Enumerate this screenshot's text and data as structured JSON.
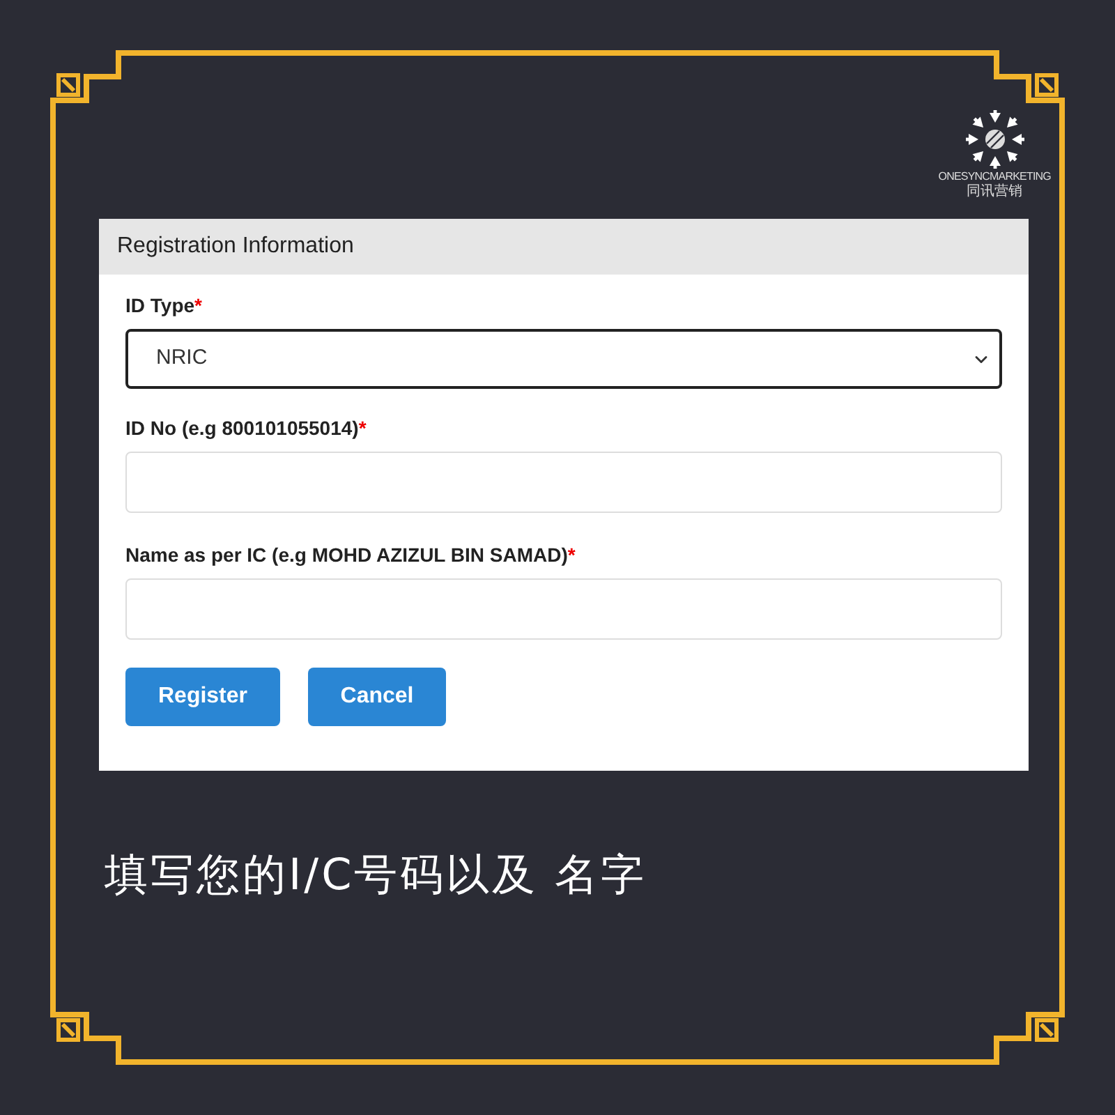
{
  "logo": {
    "name": "ONESYNCMARKETING",
    "subtitle": "同讯营销"
  },
  "form": {
    "title": "Registration Information",
    "fields": [
      {
        "kind": "select",
        "label": "ID Type",
        "required": "*",
        "value": "NRIC"
      },
      {
        "kind": "text",
        "label": "ID No (e.g 800101055014)",
        "required": "*"
      },
      {
        "kind": "text",
        "label": "Name as per IC (e.g MOHD AZIZUL BIN SAMAD)",
        "required": "*"
      }
    ],
    "buttons": [
      "Register",
      "Cancel"
    ]
  },
  "caption": "填写您的I/C号码以及 名字"
}
